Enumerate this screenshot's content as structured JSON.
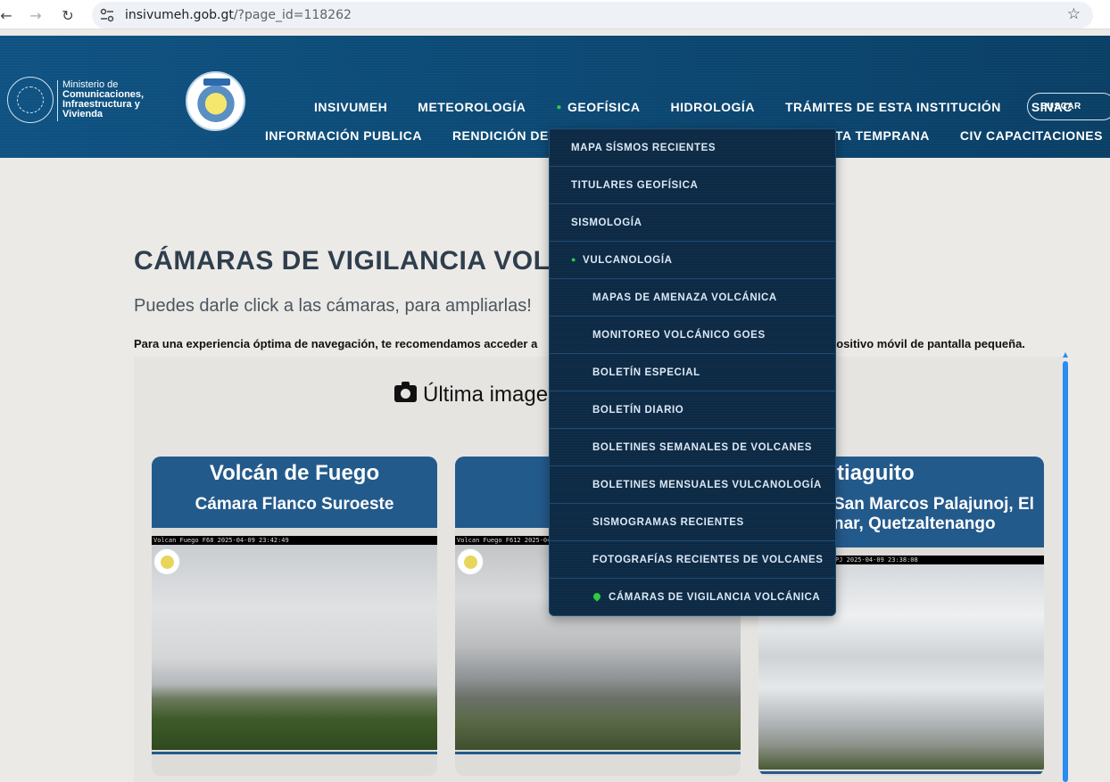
{
  "browser": {
    "url_host": "insivumeh.gob.gt",
    "url_path": "/?page_id=118262"
  },
  "header": {
    "ministerio_line1": "Ministerio de",
    "ministerio_line2": "Comunicaciones,",
    "ministerio_line3": "Infraestructura y",
    "ministerio_line4": "Vivienda",
    "search_label": "BUSCAR",
    "menu_row1": [
      "INSIVUMEH",
      "METEOROLOGÍA",
      "GEOFÍSICA",
      "HIDROLOGÍA",
      "TRÁMITES DE ESTA INSTITUCIÓN",
      "SINAC"
    ],
    "menu_row2": [
      "INFORMACIÓN PUBLICA",
      "RENDICIÓN DE CU",
      "TA TEMPRANA",
      "CIV CAPACITACIONES"
    ]
  },
  "dropdown": {
    "items": [
      {
        "label": "MAPA SÍSMOS RECIENTES",
        "level": 1
      },
      {
        "label": "TITULARES GEOFÍSICA",
        "level": 1
      },
      {
        "label": "SISMOLOGÍA",
        "level": 1
      },
      {
        "label": "VULCANOLOGÍA",
        "level": 1,
        "active": true
      },
      {
        "label": "MAPAS DE AMENAZA VOLCÁNICA",
        "level": 2
      },
      {
        "label": "MONITOREO VOLCÁNICO GOES",
        "level": 2
      },
      {
        "label": "BOLETÍN ESPECIAL",
        "level": 2
      },
      {
        "label": "BOLETÍN DIARIO",
        "level": 2
      },
      {
        "label": "BOLETINES SEMANALES DE VOLCANES",
        "level": 2
      },
      {
        "label": "BOLETINES MENSUALES VULCANOLOGÍA",
        "level": 2
      },
      {
        "label": "SISMOGRAMAS RECIENTES",
        "level": 2
      },
      {
        "label": "FOTOGRAFÍAS RECIENTES DE VOLCANES",
        "level": 2
      },
      {
        "label": "CÁMARAS DE VIGILANCIA VOLCÁNICA",
        "level": 2,
        "current": true
      }
    ]
  },
  "content": {
    "title": "CÁMARAS DE VIGILANCIA VOLCÁN",
    "subtitle": "Puedes darle click a las cámaras, para ampliarlas!",
    "note_start": "Para una experiencia óptima de navegación, te recomendamos acceder a",
    "note_end": "positivo móvil de pantalla pequeña.",
    "panel_heading": "Última image"
  },
  "cards": [
    {
      "title": "Volcán de Fuego",
      "camera": "Cámara Flanco Suroeste",
      "stamp": "Volcan Fuego F68 2025-04-09 23:42:49"
    },
    {
      "title": "Volc",
      "camera": "Cáma",
      "stamp": "Volcan Fuego F612 2025-04-0"
    },
    {
      "title": "cán Santiaguito",
      "camera": "San Marcos Palajunoj, El nar, Quetzaltenango",
      "stamp": "PJ 2025-04-09 23:38:08"
    }
  ],
  "colors": {
    "header_blue": "#0c4b77",
    "card_blue": "#235a8c",
    "accent_green": "#2ecc40",
    "dropdown_bg": "#0d2a45"
  }
}
